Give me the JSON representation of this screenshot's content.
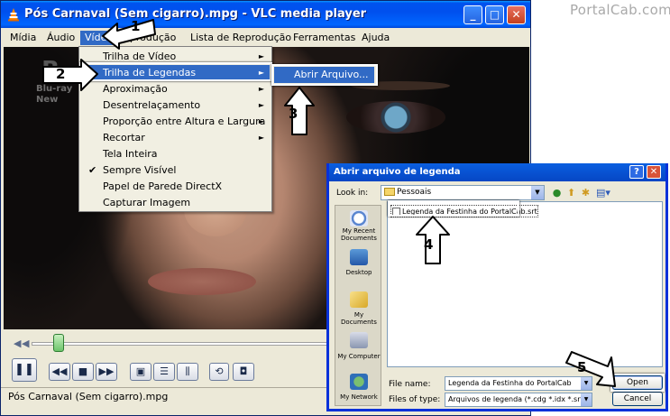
{
  "watermark": "PortalCab.com",
  "window": {
    "title": "Pós Carnaval (Sem cigarro).mpg - VLC media player",
    "min": "_",
    "max": "□",
    "close": "✕"
  },
  "menubar": [
    "Mídia",
    "Áudio",
    "Vídeo",
    "Reprodução",
    "Lista de Reprodução",
    "Ferramentas",
    "Ajuda"
  ],
  "video_logo": {
    "letter": "B",
    "line1": "Blu-ray",
    "line2": "New"
  },
  "video_menu": {
    "items": [
      {
        "label": "Trilha de Vídeo",
        "submenu": true
      },
      {
        "label": "Trilha de Legendas",
        "submenu": true,
        "highlighted": true
      },
      {
        "label": "Aproximação",
        "submenu": true
      },
      {
        "label": "Desentrelaçamento",
        "submenu": true
      },
      {
        "label": "Proporção entre Altura e Largura",
        "submenu": true
      },
      {
        "label": "Recortar",
        "submenu": true
      },
      {
        "label": "Tela Inteira"
      },
      {
        "label": "Sempre Visível",
        "checked": true
      },
      {
        "label": "Papel de Parede DirectX"
      },
      {
        "label": "Capturar Imagem"
      }
    ],
    "submenu_arrow": "►",
    "check_mark": "✔"
  },
  "subtitle_submenu": {
    "label": "Abrir Arquivo..."
  },
  "controls": {
    "seek_position": 0.09,
    "pause": "❚❚",
    "prev": "◀◀",
    "stop": "■",
    "next": "▶▶",
    "fullscreen": "▣",
    "playlist": "☰",
    "extended": "⫼",
    "loop": "⟲",
    "snapshot": "◘",
    "seek_left": "◀",
    "seek_right": "▶"
  },
  "status": "Pós Carnaval (Sem cigarro).mpg",
  "dialog": {
    "title": "Abrir arquivo de legenda",
    "help": "?",
    "close": "✕",
    "lookin_label": "Look in:",
    "lookin_value": "Pessoais",
    "places": [
      "My Recent Documents",
      "Desktop",
      "My Documents",
      "My Computer",
      "My Network"
    ],
    "file": "Legenda da Festinha do PortalCab.srt",
    "filename_label": "File name:",
    "filename_value": "Legenda da Festinha do PortalCab",
    "filetype_label": "Files of type:",
    "filetype_value": "Arquivos de legenda (*.cdg *.idx *.srt *.sub *.ut",
    "open": "Open",
    "cancel": "Cancel"
  },
  "steps": [
    "1",
    "2",
    "3",
    "4",
    "5"
  ]
}
